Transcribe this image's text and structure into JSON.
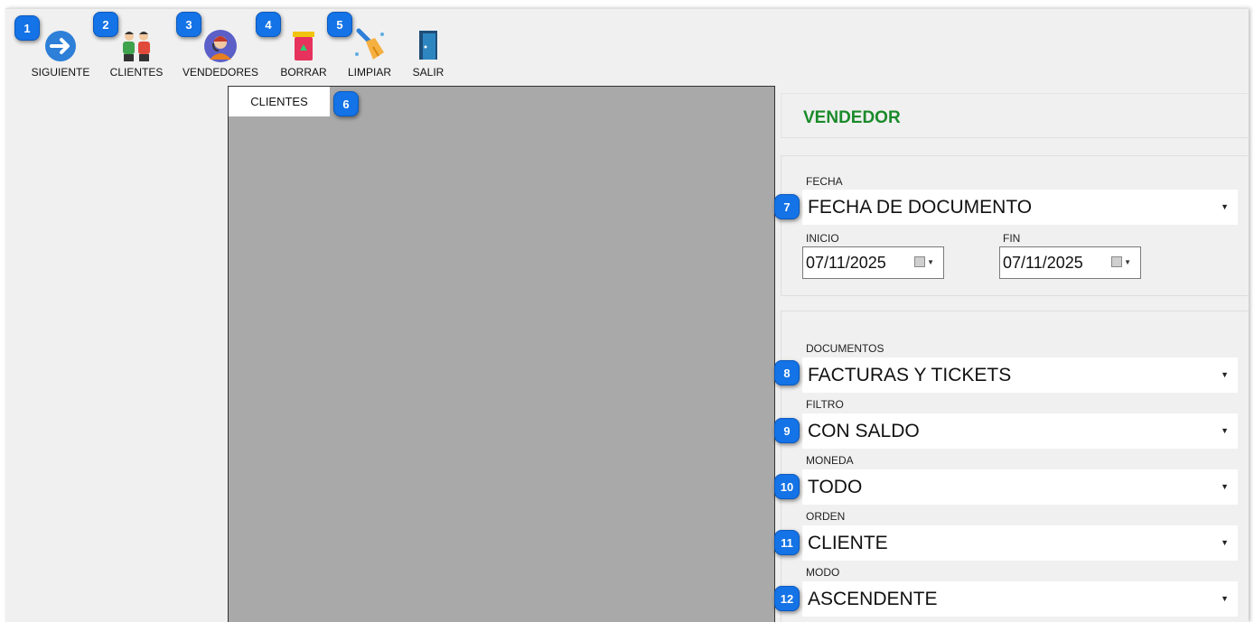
{
  "toolbar": {
    "items": [
      {
        "label": "SIGUIENTE",
        "icon": "arrow-right-icon",
        "badge": "1"
      },
      {
        "label": "CLIENTES",
        "icon": "customers-icon",
        "badge": "2"
      },
      {
        "label": "VENDEDORES",
        "icon": "salesperson-icon",
        "badge": "3"
      },
      {
        "label": "BORRAR",
        "icon": "trash-icon",
        "badge": "4"
      },
      {
        "label": "LIMPIAR",
        "icon": "broom-icon",
        "badge": "5"
      },
      {
        "label": "SALIR",
        "icon": "exit-door-icon"
      }
    ]
  },
  "tab": {
    "label": "CLIENTES",
    "badge": "6"
  },
  "panel": {
    "title": "VENDEDOR",
    "fecha_label": "FECHA",
    "fecha_value": "FECHA DE DOCUMENTO",
    "fecha_badge": "7",
    "inicio_label": "INICIO",
    "inicio_value": "07/11/2025",
    "fin_label": "FIN",
    "fin_value": "07/11/2025",
    "documentos_label": "DOCUMENTOS",
    "documentos_value": "FACTURAS Y TICKETS",
    "documentos_badge": "8",
    "filtro_label": "FILTRO",
    "filtro_value": "CON SALDO",
    "filtro_badge": "9",
    "moneda_label": "MONEDA",
    "moneda_value": "TODO",
    "moneda_badge": "10",
    "orden_label": "ORDEN",
    "orden_value": "CLIENTE",
    "orden_badge": "11",
    "modo_label": "MODO",
    "modo_value": "ASCENDENTE",
    "modo_badge": "12"
  },
  "colors": {
    "callout": "#1473e6",
    "title": "#1a8a2a",
    "grid_bg": "#a9a9a9"
  }
}
